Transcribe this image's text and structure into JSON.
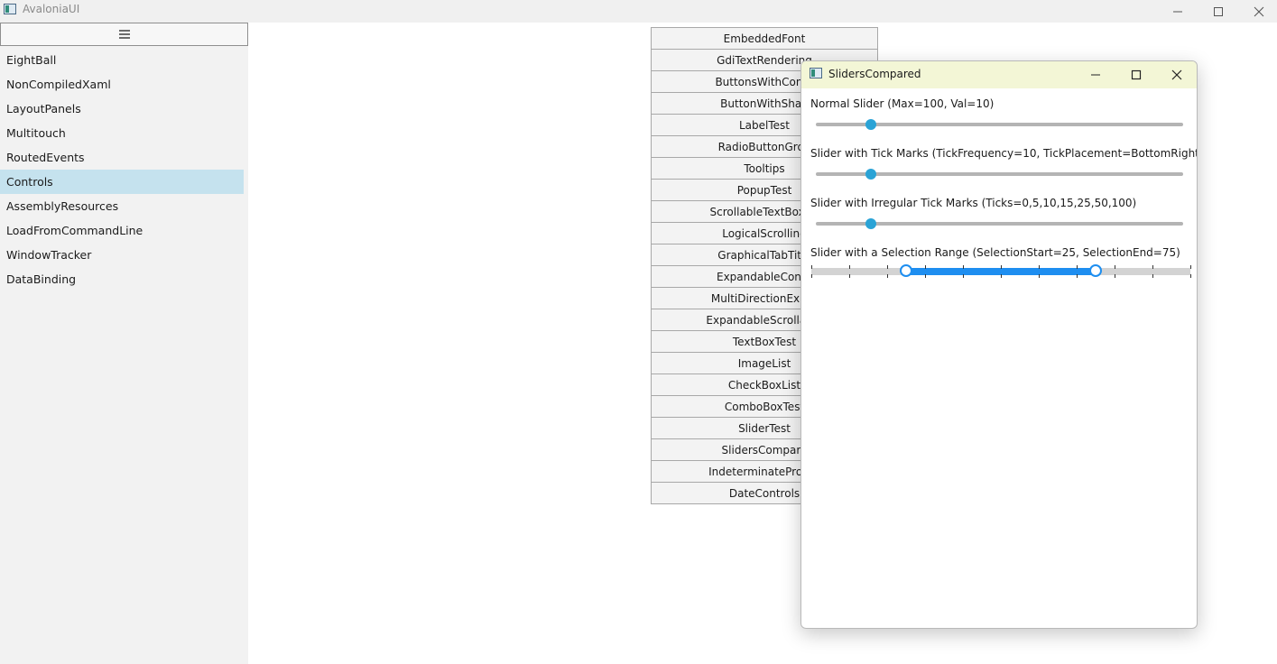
{
  "window": {
    "title": "AvaloniaUI"
  },
  "sidebar": {
    "menu_icon": "hamburger-menu-icon",
    "items": [
      {
        "label": "EightBall"
      },
      {
        "label": "NonCompiledXaml"
      },
      {
        "label": "LayoutPanels"
      },
      {
        "label": "Multitouch"
      },
      {
        "label": "RoutedEvents"
      },
      {
        "label": "Controls",
        "selected": true
      },
      {
        "label": "AssemblyResources"
      },
      {
        "label": "LoadFromCommandLine"
      },
      {
        "label": "WindowTracker"
      },
      {
        "label": "DataBinding"
      }
    ],
    "selected_color": "#c5e2ee"
  },
  "buttons": [
    "EmbeddedFont",
    "GdiTextRendering",
    "ButtonsWithConte",
    "ButtonWithShap",
    "LabelTest",
    "RadioButtonGrou",
    "Tooltips",
    "PopupTest",
    "ScrollableTextBoxCo",
    "LogicalScrolling",
    "GraphicalTabTitle",
    "ExpandableConte",
    "MultiDirectionExpar",
    "ExpandableScrollable",
    "TextBoxTest",
    "ImageList",
    "CheckBoxList",
    "ComboBoxTest",
    "SliderTest",
    "SlidersCompare",
    "IndeterminateProgre",
    "DateControls"
  ],
  "child_window": {
    "title": "SlidersCompared",
    "titlebar_color": "#f3f6d6",
    "sliders": [
      {
        "label": "Normal Slider (Max=100, Val=10)",
        "max": 100,
        "value": 10
      },
      {
        "label": "Slider with Tick Marks (TickFrequency=10, TickPlacement=BottomRight)",
        "max": 100,
        "value": 10
      },
      {
        "label": "Slider with Irregular Tick Marks (Ticks=0,5,10,15,25,50,100)",
        "max": 100,
        "value": 10
      },
      {
        "label": "Slider with a Selection Range (SelectionStart=25, SelectionEnd=75)",
        "max": 100,
        "selection_start": 25,
        "selection_end": 75
      }
    ],
    "accent_color": "#2aa3d6",
    "range_color": "#1e8ef0"
  }
}
